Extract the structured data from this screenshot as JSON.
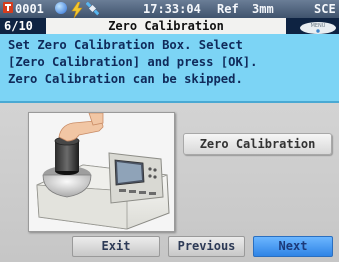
{
  "status_bar": {
    "session_number": "0001",
    "time": "17:33:04",
    "reference": "Ref",
    "aperture": "3mm",
    "specular_mode": "SCE",
    "icons": [
      "measurement-icon",
      "sphere-icon",
      "lightning-icon",
      "satellite-icon"
    ]
  },
  "header": {
    "page_counter": "6/10",
    "title": "Zero Calibration",
    "menu_badge": "MENU",
    "colors": {
      "background": "#0e2342",
      "title_bar": "#f2f2f0"
    }
  },
  "instruction": {
    "lines": [
      "Set Zero Calibration Box. Select",
      "[Zero Calibration] and press [OK].",
      "Zero Calibration can be skipped."
    ],
    "background_color": "#7cd4f5"
  },
  "illustration": {
    "icon": "spectrophotometer-with-zero-calibration-box-image"
  },
  "actions": {
    "zero_calibration_label": "Zero Calibration"
  },
  "navigation": {
    "exit_label": "Exit",
    "previous_label": "Previous",
    "next_label": "Next",
    "selected": "Next",
    "selected_color": "#3b95f5"
  }
}
